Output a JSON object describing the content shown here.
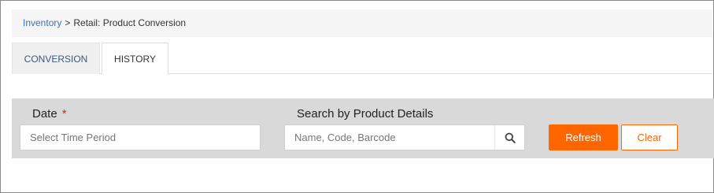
{
  "breadcrumb": {
    "root": "Inventory",
    "separator": ">",
    "current": "Retail: Product Conversion"
  },
  "tabs": [
    {
      "label": "CONVERSION"
    },
    {
      "label": "HISTORY"
    }
  ],
  "active_tab": "HISTORY",
  "filters": {
    "date_label": "Date",
    "date_required_marker": "*",
    "date_placeholder": "Select Time Period",
    "search_label": "Search by Product Details",
    "search_placeholder": "Name, Code, Barcode"
  },
  "actions": {
    "refresh_label": "Refresh",
    "clear_label": "Clear"
  },
  "colors": {
    "accent": "#ff6600",
    "link": "#3f6fb5",
    "panel": "#d9d9d9"
  }
}
